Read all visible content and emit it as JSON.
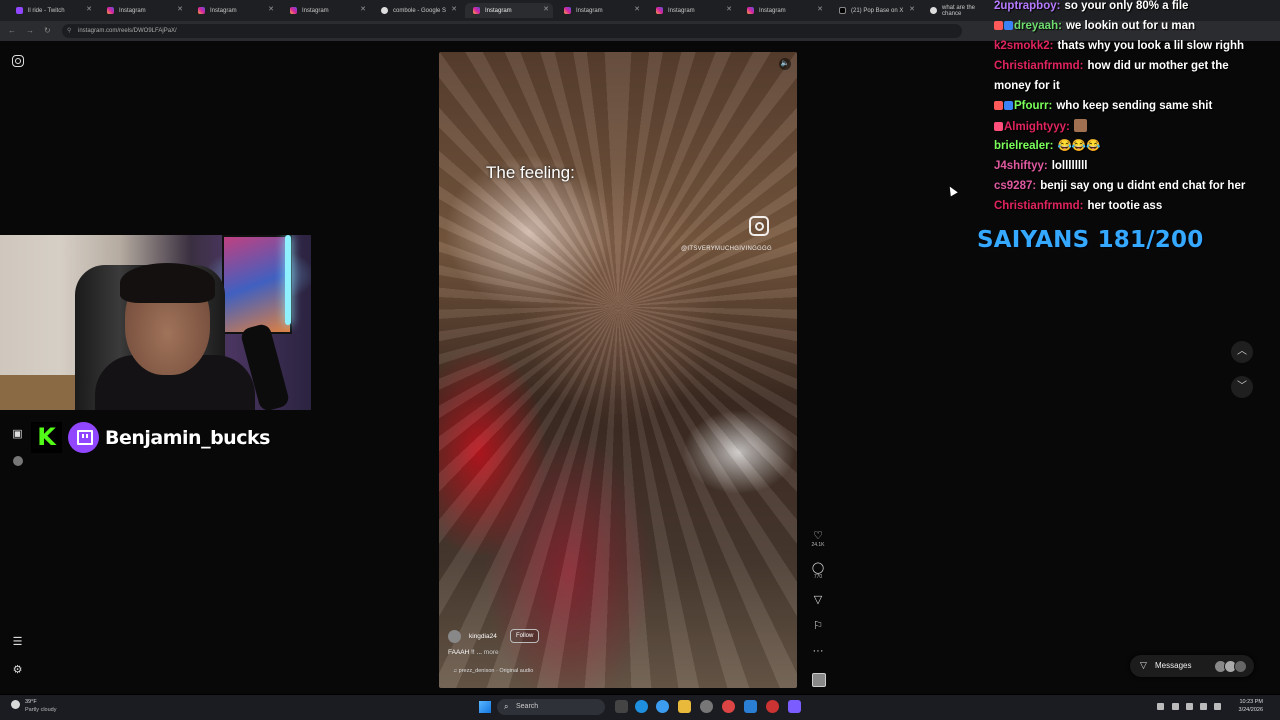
{
  "browser": {
    "tabs": [
      {
        "label": "ll ride - Twitch",
        "icon": "twitch-icon"
      },
      {
        "label": "Instagram",
        "icon": "instagram-icon"
      },
      {
        "label": "Instagram",
        "icon": "instagram-icon"
      },
      {
        "label": "Instagram",
        "icon": "instagram-icon"
      },
      {
        "label": "combole - Google S",
        "icon": "google-icon"
      },
      {
        "label": "Instagram",
        "icon": "instagram-icon"
      },
      {
        "label": "Instagram",
        "icon": "instagram-icon"
      },
      {
        "label": "Instagram",
        "icon": "instagram-icon"
      },
      {
        "label": "Instagram",
        "icon": "instagram-icon"
      },
      {
        "label": "(21) Pop Base on X",
        "icon": "x-icon"
      },
      {
        "label": "what are the chance",
        "icon": "google-icon"
      }
    ],
    "url": "instagram.com/reels/DWO9LFAjPaX/"
  },
  "reel": {
    "overlay_text": "The feeling:",
    "watermark": "@ITSVERYMUCHGIVINGGGG",
    "author": "kingdia24",
    "follow_label": "Follow",
    "description": "FAAAH !! ...",
    "more_label": "more",
    "audio": "prezz_denison · Original audio",
    "likes": "24.1K",
    "comments": "770"
  },
  "messages_label": "Messages",
  "stream": {
    "streamer_name": "Benjamin_bucks",
    "kick_logo": "K",
    "goal": "SAIYANS 181/200",
    "chat": [
      {
        "user": "2uptrapboy:",
        "text": "so your only 80% a file",
        "color": "#b57bff",
        "badges": []
      },
      {
        "user": "dreyaah:",
        "text": "we lookin out for u man",
        "color": "#6fdc6f",
        "badges": [
          "#ff5a5a",
          "#3b82f6"
        ]
      },
      {
        "user": "k2smokk2:",
        "text": "thats why you look a lil slow righh",
        "color": "#e0245e",
        "badges": []
      },
      {
        "user": "Christianfrmmd:",
        "text": "how did ur mother get the",
        "color": "#e0245e",
        "badges": []
      },
      {
        "user": "",
        "text": "money for it",
        "color": "#ffffff",
        "badges": []
      },
      {
        "user": "Pfourr:",
        "text": "who keep sending same shit",
        "color": "#7bff5a",
        "badges": [
          "#ff5a5a",
          "#3b82f6"
        ]
      },
      {
        "user": "Almightyyy:",
        "text": "",
        "color": "#e0245e",
        "badges": [
          "#ff4f7a"
        ]
      },
      {
        "user": "brielrealer:",
        "text": "😂😂😂",
        "color": "#7bff5a",
        "badges": []
      },
      {
        "user": "J4shiftyy:",
        "text": "lollllllll",
        "color": "#e05aa0",
        "badges": []
      },
      {
        "user": "cs9287:",
        "text": "benji say ong u didnt end chat for her",
        "color": "#e05aa0",
        "badges": []
      },
      {
        "user": "Christianfrmmd:",
        "text": "her tootie ass",
        "color": "#e0245e",
        "badges": []
      }
    ]
  },
  "taskbar": {
    "temp": "39°F",
    "weather": "Partly cloudy",
    "search_label": "Search",
    "time": "10:23 PM",
    "date": "3/24/2026"
  },
  "colors": {
    "accent": "#35a8ff",
    "twitch": "#9146ff",
    "kick": "#53fc18"
  }
}
